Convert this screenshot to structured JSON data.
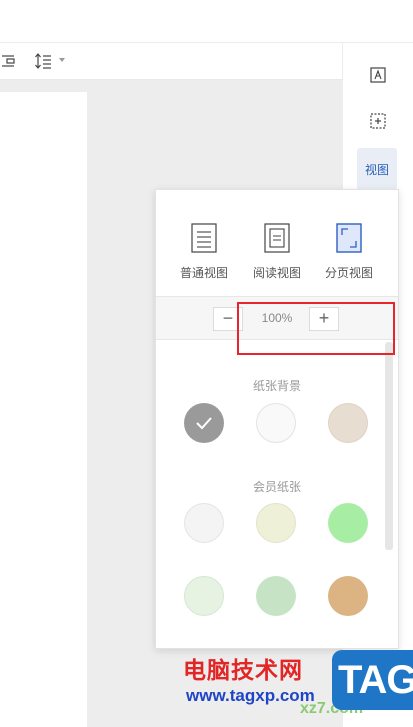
{
  "right_strip": {
    "view_tab_label": "视图"
  },
  "view_panel": {
    "views": [
      {
        "label": "普通视图"
      },
      {
        "label": "阅读视图"
      },
      {
        "label": "分页视图",
        "selected": true
      }
    ],
    "zoom": {
      "minus_label": "−",
      "value": "100%",
      "plus_label": "+"
    },
    "paper_background": {
      "title": "纸张背景",
      "swatches": [
        {
          "name": "gray-selected",
          "color": "#9a9a9a",
          "selected": true
        },
        {
          "name": "white-texture",
          "color": "#f9f9f9"
        },
        {
          "name": "linen",
          "color": "#e7ddd0"
        }
      ]
    },
    "member_paper": {
      "title": "会员纸张",
      "swatches": [
        {
          "name": "white-leaf",
          "color": "#f4f4f4"
        },
        {
          "name": "cream-pattern",
          "color": "#eef1d8"
        },
        {
          "name": "green-light",
          "color": "#a8eda4"
        },
        {
          "name": "mint",
          "color": "#e6f2e2"
        },
        {
          "name": "sage",
          "color": "#c6e4c5"
        },
        {
          "name": "wood",
          "color": "#dcb382"
        }
      ]
    }
  },
  "annotation": {
    "highlight_color": "#e8252a"
  },
  "watermark": {
    "title": "电脑技术网",
    "url": "www.tagxp.com",
    "logo": "TAG",
    "url2": "xz7.com"
  }
}
